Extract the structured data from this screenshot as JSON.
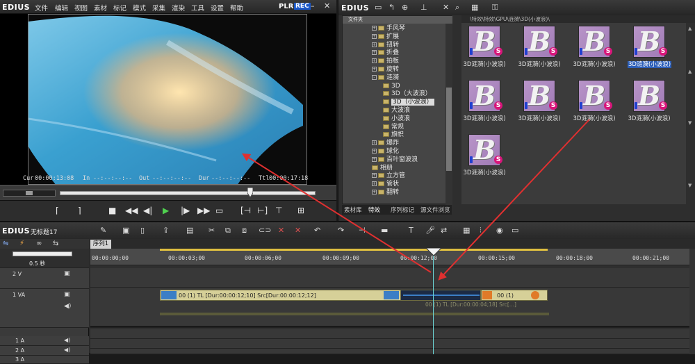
{
  "player": {
    "brand": "EDIUS",
    "menu": [
      "文件",
      "编辑",
      "视图",
      "素材",
      "标记",
      "模式",
      "采集",
      "渲染",
      "工具",
      "设置",
      "帮助"
    ],
    "plr": "PLR",
    "rec": "REC",
    "timecodes": {
      "cur_label": "Cur",
      "cur": "00:00:13:08",
      "in_label": "In",
      "in": "--:--:--:--",
      "out_label": "Out",
      "out": "--:--:--:--",
      "dur_label": "Dur",
      "dur": "--:--:--:--",
      "ttl_label": "Ttl",
      "ttl": "00:00:17:18"
    }
  },
  "bin": {
    "brand": "EDIUS",
    "folder_header": "文件夹",
    "path": "\\特效\\特效\\GPU\\涟漪\\3D(小波浪)\\",
    "tree": [
      {
        "label": "手风琴",
        "level": 1,
        "expander": "+"
      },
      {
        "label": "扩展",
        "level": 1,
        "expander": "+"
      },
      {
        "label": "扭转",
        "level": 1,
        "expander": "+"
      },
      {
        "label": "折叠",
        "level": 1,
        "expander": "+"
      },
      {
        "label": "拍板",
        "level": 1,
        "expander": "+"
      },
      {
        "label": "旋转",
        "level": 1,
        "expander": "+"
      },
      {
        "label": "涟漪",
        "level": 1,
        "expander": "-"
      },
      {
        "label": "3D",
        "level": 2,
        "expander": ""
      },
      {
        "label": "3D（大波浪）",
        "level": 2,
        "expander": ""
      },
      {
        "label": "3D（小波浪）",
        "level": 2,
        "expander": "",
        "selected": true
      },
      {
        "label": "大波浪",
        "level": 2,
        "expander": ""
      },
      {
        "label": "小波浪",
        "level": 2,
        "expander": ""
      },
      {
        "label": "常规",
        "level": 2,
        "expander": ""
      },
      {
        "label": "旗帜",
        "level": 2,
        "expander": ""
      },
      {
        "label": "爆炸",
        "level": 1,
        "expander": "+"
      },
      {
        "label": "球化",
        "level": 1,
        "expander": "+"
      },
      {
        "label": "百叶窗波浪",
        "level": 1,
        "expander": "+"
      },
      {
        "label": "相册",
        "level": 1,
        "expander": ""
      },
      {
        "label": "立方管",
        "level": 1,
        "expander": "+"
      },
      {
        "label": "管状",
        "level": 1,
        "expander": "+"
      },
      {
        "label": "翻转",
        "level": 1,
        "expander": "+"
      }
    ],
    "tabs": [
      "素材库",
      "特效",
      "序列标记",
      "源文件浏览"
    ],
    "active_tab": 1,
    "clips": [
      {
        "label": "3D涟漪(小波浪)",
        "selected": false
      },
      {
        "label": "3D涟漪(小波浪)",
        "selected": false
      },
      {
        "label": "3D涟漪(小波浪)",
        "selected": false
      },
      {
        "label": "3D涟漪(小波浪)",
        "selected": true
      },
      {
        "label": "3D涟漪(小波浪)",
        "selected": false
      },
      {
        "label": "3D涟漪(小波浪)",
        "selected": false
      },
      {
        "label": "3D涟漪(小波浪)",
        "selected": false
      },
      {
        "label": "3D涟漪(小波浪)",
        "selected": false
      },
      {
        "label": "3D涟漪(小波浪)",
        "selected": false
      }
    ]
  },
  "timeline": {
    "brand": "EDIUS",
    "project_name": "无标题17",
    "sequence_tab": "序列1",
    "zoom": "0.5 秒",
    "ruler_ticks": [
      "00:00:00;00",
      "00:00:03;00",
      "00:00:06;00",
      "00:00:09;00",
      "00:00:12;00",
      "00:00:15;00",
      "00:00:18;00",
      "00:00:21;00"
    ],
    "tracks": [
      {
        "name": "2 V"
      },
      {
        "name": "1 VA"
      },
      {
        "name": "1 A"
      },
      {
        "name": "2 A"
      },
      {
        "name": "3 A"
      }
    ],
    "clip_main": "00 (1)  TL [Dur:00:00:12;10]  Src[Dur:00:00:12;12]",
    "clip_right": "00 (1)",
    "clip_transition": "00 (1)  TL [Dur:00:00:04;18]  Src[...]"
  },
  "colors": {
    "accent": "#1a57c8",
    "playhead": "#6bd3d3",
    "arrow": "#e03030"
  }
}
